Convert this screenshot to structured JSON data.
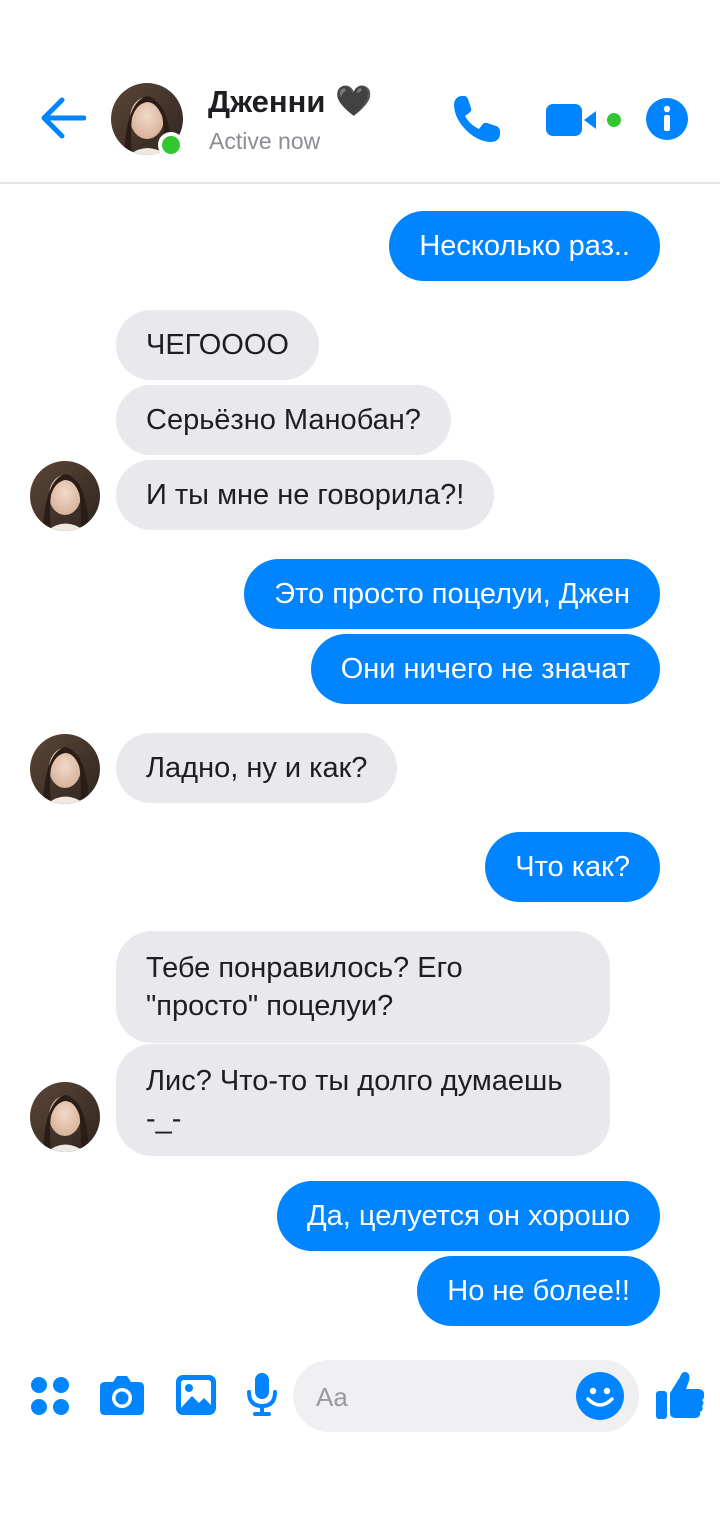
{
  "header": {
    "contact_name": "Дженни",
    "heart": "🖤",
    "status": "Active now"
  },
  "messages": [
    {
      "side": "out",
      "text": "Несколько раз.."
    },
    {
      "side": "in",
      "text": "ЧЕГОООО"
    },
    {
      "side": "in",
      "text": "Серьёзно Манобан?"
    },
    {
      "side": "in",
      "text": "И ты мне не говорила?!"
    },
    {
      "side": "out",
      "text": "Это просто поцелуи, Джен"
    },
    {
      "side": "out",
      "text": "Они ничего не значат"
    },
    {
      "side": "in",
      "text": "Ладно, ну и как?"
    },
    {
      "side": "out",
      "text": "Что как?"
    },
    {
      "side": "in",
      "text": "Тебе понравилось? Его \"просто\" поцелуи?"
    },
    {
      "side": "in",
      "text": "Лис? Что-то ты долго думаешь -_-"
    },
    {
      "side": "out",
      "text": "Да, целуется он хорошо"
    },
    {
      "side": "out",
      "text": "Но не более!!"
    }
  ],
  "composer": {
    "placeholder": "Aa"
  },
  "colors": {
    "accent": "#0084ff",
    "incoming_bubble": "#e9e8ec",
    "online": "#31c730"
  },
  "icons": [
    "back-arrow-icon",
    "phone-icon",
    "video-icon",
    "info-icon",
    "apps-icon",
    "camera-icon",
    "gallery-icon",
    "microphone-icon",
    "emoji-icon",
    "like-icon"
  ]
}
